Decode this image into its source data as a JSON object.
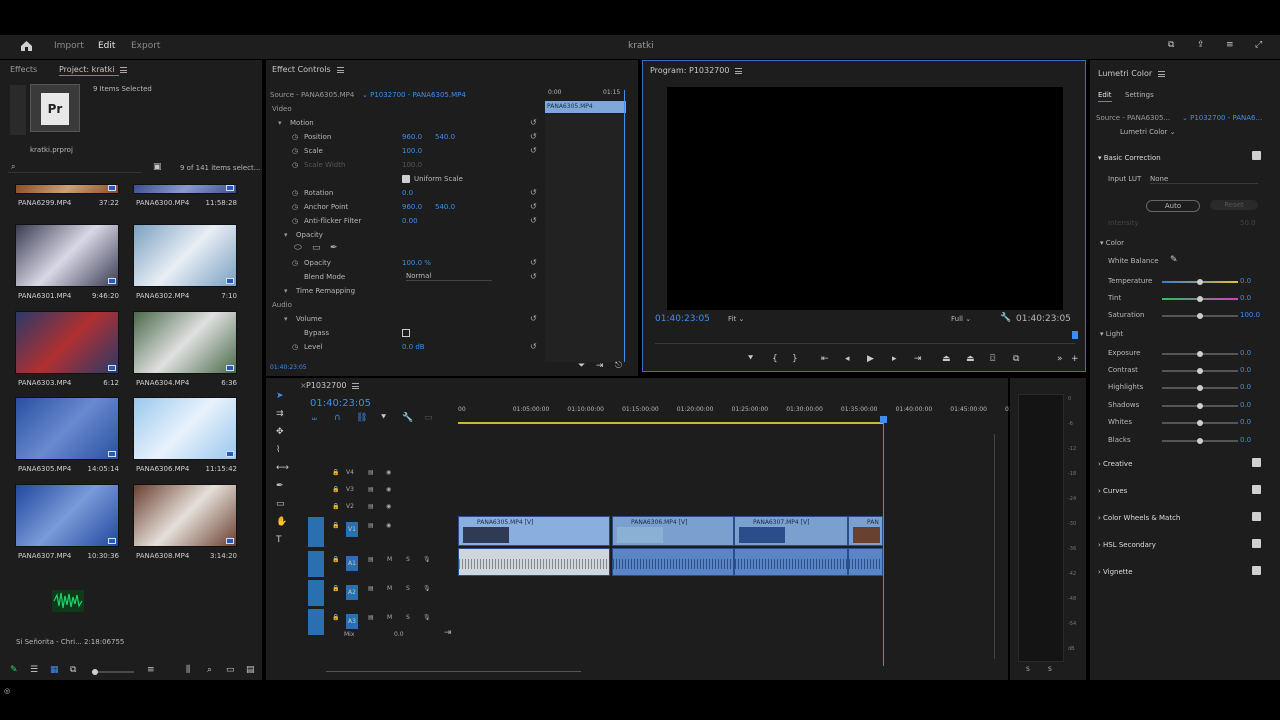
{
  "topbar": {
    "import": "Import",
    "edit": "Edit",
    "export": "Export",
    "project_title": "kratki"
  },
  "project": {
    "tab_effects": "Effects",
    "tab_project": "Project: kratki",
    "selected": "9 Items Selected",
    "file": "kratki.prproj",
    "count": "9 of 141 items select...",
    "items": [
      {
        "name": "PANA6299.MP4",
        "dur": "37:22",
        "colors": [
          "#8c4a2a",
          "#c9a27a"
        ]
      },
      {
        "name": "PANA6300.MP4",
        "dur": "11:58:28",
        "colors": [
          "#3d4e90",
          "#8a9ad0"
        ]
      },
      {
        "name": "PANA6301.MP4",
        "dur": "9:46:20",
        "colors": [
          "#3b3b52",
          "#d8d8e6"
        ]
      },
      {
        "name": "PANA6302.MP4",
        "dur": "7:10",
        "colors": [
          "#7aa0c0",
          "#e8eef5"
        ]
      },
      {
        "name": "PANA6303.MP4",
        "dur": "6:12",
        "colors": [
          "#2a3a6a",
          "#b03030"
        ]
      },
      {
        "name": "PANA6304.MP4",
        "dur": "6:36",
        "colors": [
          "#4a6a4a",
          "#e0e0e0"
        ]
      },
      {
        "name": "PANA6305.MP4",
        "dur": "14:05:14",
        "colors": [
          "#2850a0",
          "#6a8ad0"
        ]
      },
      {
        "name": "PANA6306.MP4",
        "dur": "11:15:42",
        "colors": [
          "#9ac8ee",
          "#e8f2fc"
        ]
      },
      {
        "name": "PANA6307.MP4",
        "dur": "10:30:36",
        "colors": [
          "#2248a0",
          "#7a9ad8"
        ]
      },
      {
        "name": "PANA6308.MP4",
        "dur": "3:14:20",
        "colors": [
          "#6a4030",
          "#e6e0da"
        ]
      }
    ],
    "audio_item": {
      "name": "Si Señorita - Chri...",
      "dur": "2:18:06755"
    }
  },
  "effect_controls": {
    "title": "Effect Controls",
    "source": "Source - PANA6305.MP4",
    "seq": "P1032700 - PANA6305.MP4",
    "t0": "0:00",
    "t1": "01:15",
    "clip": "PANA6305.MP4",
    "video": "Video",
    "motion": "Motion",
    "position": "Position",
    "pos_x": "960.0",
    "pos_y": "540.0",
    "scale": "Scale",
    "scale_v": "100.0",
    "scale_width": "Scale Width",
    "scale_width_v": "100.0",
    "uniform": "Uniform Scale",
    "rotation": "Rotation",
    "rotation_v": "0.0",
    "anchor": "Anchor Point",
    "anc_x": "960.0",
    "anc_y": "540.0",
    "flicker": "Anti-flicker Filter",
    "flicker_v": "0.00",
    "opacity_grp": "Opacity",
    "opacity": "Opacity",
    "opacity_v": "100.0 %",
    "blend": "Blend Mode",
    "blend_v": "Normal",
    "time_remap": "Time Remapping",
    "audio": "Audio",
    "volume": "Volume",
    "bypass": "Bypass",
    "level": "Level",
    "level_v": "0.0 dB",
    "timecode": "01:40:23:05"
  },
  "program": {
    "title": "Program: P1032700",
    "timecode": "01:40:23:05",
    "fit": "Fit",
    "full": "Full",
    "duration": "01:40:23:05"
  },
  "timeline": {
    "seq": "P1032700",
    "timecode": "01:40:23:05",
    "ruler": [
      "00",
      "01:05:00:00",
      "01:10:00:00",
      "01:15:00:00",
      "01:20:00:00",
      "01:25:00:00",
      "01:30:00:00",
      "01:35:00:00",
      "01:40:00:00",
      "01:45:00:00",
      "01:50:0"
    ],
    "tracks": [
      "V4",
      "V3",
      "V2",
      "V1",
      "A1",
      "A2",
      "A3"
    ],
    "mix": "Mix",
    "mix_v": "0.0",
    "clips": [
      "PANA6305.MP4 [V]",
      "PANA6306.MP4 [V]",
      "PANA6307.MP4 [V]",
      "PAN"
    ],
    "meter": [
      "0",
      "-6",
      "-12",
      "-18",
      "-24",
      "-30",
      "-36",
      "-42",
      "-48",
      "-54",
      "dB"
    ],
    "solo": "S"
  },
  "lumetri": {
    "title": "Lumetri Color",
    "tab_edit": "Edit",
    "tab_settings": "Settings",
    "source": "Source - PANA6305...",
    "seq": "P1032700 - PANA6...",
    "effect": "Lumetri Color",
    "basic": "Basic Correction",
    "input_lut": "Input LUT",
    "lut_v": "None",
    "auto": "Auto",
    "reset": "Reset",
    "intensity": "Intensity",
    "intensity_v": "50.0",
    "color": "Color",
    "wb": "White Balance",
    "temperature": "Temperature",
    "temp_v": "0.0",
    "tint": "Tint",
    "tint_v": "0.0",
    "saturation": "Saturation",
    "sat_v": "100.0",
    "light": "Light",
    "exposure": "Exposure",
    "exposure_v": "0.0",
    "contrast": "Contrast",
    "contrast_v": "0.0",
    "highlights": "Highlights",
    "highlights_v": "0.0",
    "shadows": "Shadows",
    "shadows_v": "0.0",
    "whites": "Whites",
    "whites_v": "0.0",
    "blacks": "Blacks",
    "blacks_v": "0.0",
    "creative": "Creative",
    "curves": "Curves",
    "wheels": "Color Wheels & Match",
    "hsl": "HSL Secondary",
    "vignette": "Vignette"
  }
}
